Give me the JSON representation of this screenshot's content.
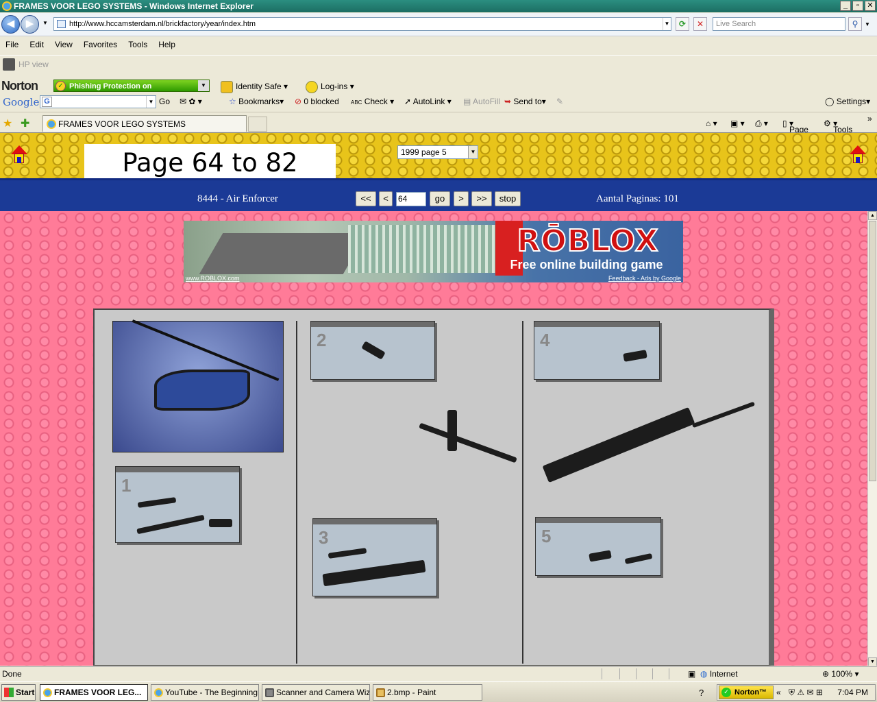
{
  "window": {
    "title": "FRAMES VOOR LEGO SYSTEMS - Windows Internet Explorer"
  },
  "address": {
    "url": "http://www.hccamsterdam.nl/brickfactory/year/index.htm",
    "search_placeholder": "Live Search"
  },
  "menu": [
    "File",
    "Edit",
    "View",
    "Favorites",
    "Tools",
    "Help"
  ],
  "hpbar": {
    "label": "HP view"
  },
  "norton": {
    "logo": "Norton",
    "phishing": "Phishing Protection on",
    "identity": "Identity Safe",
    "logins": "Log-ins"
  },
  "google": {
    "logo": "Google",
    "go": "Go",
    "bookmarks": "Bookmarks",
    "blocked": "0 blocked",
    "check": "Check",
    "autolink": "AutoLink",
    "autofill": "AutoFill",
    "sendto": "Send to",
    "settings": "Settings"
  },
  "tabs": [
    {
      "label": "FRAMES VOOR LEGO SYSTEMS"
    }
  ],
  "cmdbar": {
    "page": "Page",
    "tools": "Tools"
  },
  "page": {
    "title": "Page 64 to 82",
    "year_select": "1999 page 5",
    "set_name": "8444 - Air Enforcer",
    "nav": {
      "first": "<<",
      "prev": "<",
      "page_input": "64",
      "go": "go",
      "next": ">",
      "last": ">>",
      "stop": "stop"
    },
    "page_count": "Aantal Paginas: 101",
    "ad": {
      "logo": "RŌBLOX",
      "tagline": "Free online building game",
      "link_left": "www.ROBLOX.com",
      "link_right": "Feedback - Ads by Google"
    },
    "steps": [
      "1",
      "2",
      "3",
      "4",
      "5"
    ]
  },
  "status": {
    "text": "Done",
    "zone": "Internet",
    "zoom": "100%"
  },
  "taskbar": {
    "start": "Start",
    "tasks": [
      "FRAMES VOOR LEG...",
      "YouTube - The Beginning...",
      "Scanner and Camera Wiz...",
      "2.bmp - Paint"
    ],
    "tray_norton": "Norton™",
    "clock": "7:04 PM"
  }
}
